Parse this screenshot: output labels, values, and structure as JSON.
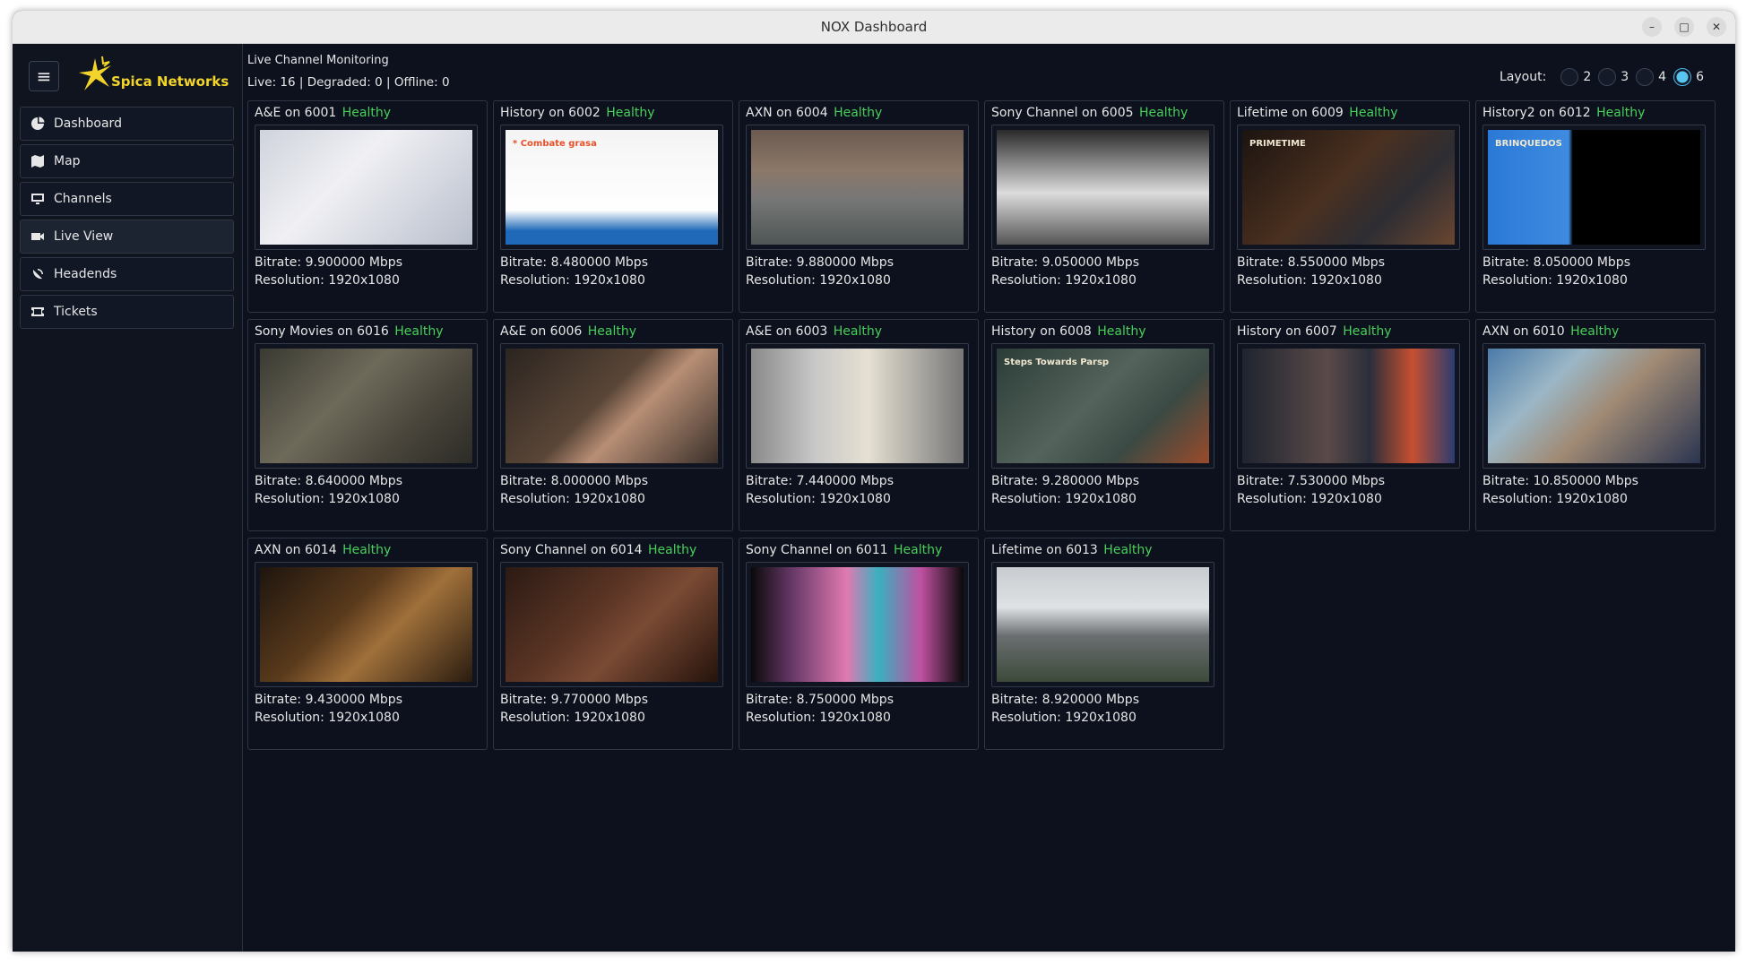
{
  "window": {
    "title": "NOX Dashboard"
  },
  "brand": {
    "name": "Spica Networks",
    "accent": "#f2d42a"
  },
  "nav": [
    {
      "label": "Dashboard",
      "icon": "pie-chart-icon"
    },
    {
      "label": "Map",
      "icon": "map-icon"
    },
    {
      "label": "Channels",
      "icon": "monitor-icon"
    },
    {
      "label": "Live View",
      "icon": "video-camera-icon",
      "active": true
    },
    {
      "label": "Headends",
      "icon": "satellite-dish-icon"
    },
    {
      "label": "Tickets",
      "icon": "ticket-icon"
    }
  ],
  "main": {
    "heading": "Live Channel Monitoring",
    "status": "Live: 16 | Degraded: 0 | Offline: 0",
    "layout_label": "Layout:",
    "layout_options": [
      "2",
      "3",
      "4",
      "6"
    ],
    "layout_selected": "6"
  },
  "bitrate_prefix": "Bitrate:",
  "resolution_prefix": "Resolution:",
  "channels": [
    {
      "name": "A&E on 6001",
      "status": "Healthy",
      "bitrate": "9.900000 Mbps",
      "resolution": "1920x1080",
      "bg": "linear-gradient(135deg,#cfd3dc 0%,#f0f0f4 40%,#b9bfcc 100%)",
      "overlay": ""
    },
    {
      "name": "History on 6002",
      "status": "Healthy",
      "bitrate": "8.480000 Mbps",
      "resolution": "1920x1080",
      "bg": "linear-gradient(180deg,#f4f4f4 0%,#ffffff 70%,#1f69b8 88%,#1f69b8 100%)",
      "overlay": "* Combate grasa"
    },
    {
      "name": "AXN on 6004",
      "status": "Healthy",
      "bitrate": "9.880000 Mbps",
      "resolution": "1920x1080",
      "bg": "linear-gradient(180deg,#6c5a50 0%,#8b7868 35%,#777 60%,#4e5655 100%)",
      "overlay": ""
    },
    {
      "name": "Sony Channel on 6005",
      "status": "Healthy",
      "bitrate": "9.050000 Mbps",
      "resolution": "1920x1080",
      "bg": "linear-gradient(180deg,#2a2a2a 0%,#8a8a8a 30%,#dcdcdc 55%,#555 100%)",
      "overlay": ""
    },
    {
      "name": "Lifetime on 6009",
      "status": "Healthy",
      "bitrate": "8.550000 Mbps",
      "resolution": "1920x1080",
      "bg": "linear-gradient(135deg,#1c1410 0%,#4a3020 45%,#2d2d33 70%,#6a4630 100%)",
      "overlay": "PRIMETIME"
    },
    {
      "name": "History2 on 6012",
      "status": "Healthy",
      "bitrate": "8.050000 Mbps",
      "resolution": "1920x1080",
      "bg": "linear-gradient(90deg,#2a79d6 0%,#3f8be0 38%,#000 40%,#000 100%)",
      "overlay": "BRINQUEDOS"
    },
    {
      "name": "Sony Movies on 6016",
      "status": "Healthy",
      "bitrate": "8.640000 Mbps",
      "resolution": "1920x1080",
      "bg": "linear-gradient(135deg,#3a3a32 0%,#6e6a5a 40%,#4a463c 70%,#2c2b26 100%)",
      "overlay": ""
    },
    {
      "name": "A&E on 6006",
      "status": "Healthy",
      "bitrate": "8.000000 Mbps",
      "resolution": "1920x1080",
      "bg": "linear-gradient(135deg,#2b2420 0%,#5a4637 45%,#b88e75 60%,#3a302a 100%)",
      "overlay": ""
    },
    {
      "name": "A&E on 6003",
      "status": "Healthy",
      "bitrate": "7.440000 Mbps",
      "resolution": "1920x1080",
      "bg": "linear-gradient(90deg,#8a8a8a 0%,#c8c8c8 30%,#e5e0d2 55%,#777 100%)",
      "overlay": ""
    },
    {
      "name": "History on 6008",
      "status": "Healthy",
      "bitrate": "9.280000 Mbps",
      "resolution": "1920x1080",
      "bg": "linear-gradient(135deg,#2b3b36 0%,#54645c 45%,#3b4a44 70%,#9a4a2a 100%)",
      "overlay": "Steps Towards Parsp"
    },
    {
      "name": "History on 6007",
      "status": "Healthy",
      "bitrate": "7.530000 Mbps",
      "resolution": "1920x1080",
      "bg": "linear-gradient(90deg,#1f2430 0%,#5a4a48 40%,#2a2e3a 60%,#c65030 80%,#2b3c70 100%)",
      "overlay": ""
    },
    {
      "name": "AXN on 6010",
      "status": "Healthy",
      "bitrate": "10.850000 Mbps",
      "resolution": "1920x1080",
      "bg": "linear-gradient(135deg,#4b7aa8 0%,#9bb7c6 30%,#a08a74 55%,#2a3550 100%)",
      "overlay": ""
    },
    {
      "name": "AXN on 6014",
      "status": "Healthy",
      "bitrate": "9.430000 Mbps",
      "resolution": "1920x1080",
      "bg": "linear-gradient(135deg,#1e150e 0%,#5a3a1c 40%,#a0703a 60%,#2a1c10 100%)",
      "overlay": ""
    },
    {
      "name": "Sony Channel on 6014",
      "status": "Healthy",
      "bitrate": "9.770000 Mbps",
      "resolution": "1920x1080",
      "bg": "linear-gradient(135deg,#2b1a14 0%,#5a3424 40%,#7a4a34 60%,#25130c 100%)",
      "overlay": ""
    },
    {
      "name": "Sony Channel on 6011",
      "status": "Healthy",
      "bitrate": "8.750000 Mbps",
      "resolution": "1920x1080",
      "bg": "linear-gradient(90deg,#0a0a0a 0%,#6a3a6a 20%,#e07ab0 45%,#3ab0c0 60%,#c050a0 80%,#0a0a0a 100%)",
      "overlay": ""
    },
    {
      "name": "Lifetime on 6013",
      "status": "Healthy",
      "bitrate": "8.920000 Mbps",
      "resolution": "1920x1080",
      "bg": "linear-gradient(180deg,#c8ccd0 0%,#dfe2e4 35%,#6a6e70 60%,#3c4a3a 100%)",
      "overlay": ""
    }
  ]
}
